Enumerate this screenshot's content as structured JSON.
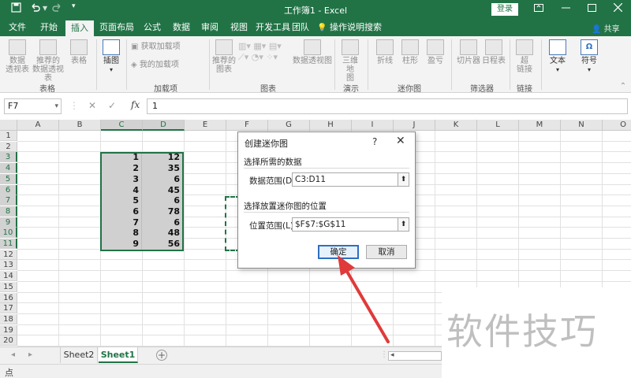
{
  "colors": {
    "excel_green": "#217346",
    "arrow_red": "#e03a3a"
  },
  "window": {
    "title": "工作簿1 - Excel",
    "login_label": "登录",
    "share_label": "共享",
    "qat": {
      "save_icon": "save-icon",
      "undo_icon": "undo-icon",
      "redo_icon": "redo-icon",
      "customize_icon": "chevron-down-icon"
    },
    "controls": {
      "restore": "restore-icon",
      "minimize": "minimize-icon",
      "maximize": "maximize-icon",
      "close": "close-icon"
    }
  },
  "ribbon": {
    "tabs": [
      "文件",
      "开始",
      "插入",
      "页面布局",
      "公式",
      "数据",
      "审阅",
      "视图",
      "开发工具",
      "团队",
      "操作说明搜索"
    ],
    "active_tab": "插入",
    "items": {
      "pivot_table": "数据\n透视表",
      "recommended_pivot": "推荐的\n数据透视表",
      "table": "表格",
      "illustrations": "插图",
      "get_addins": "获取加载项",
      "my_addins": "我的加载项",
      "recommended_charts": "推荐的\n图表",
      "pivot_chart": "数据透视图",
      "map3d": "三维地\n图",
      "line": "折线",
      "column": "柱形",
      "win_loss": "盈亏",
      "slicer": "切片器",
      "timeline": "日程表",
      "link": "超\n链接",
      "text": "文本",
      "symbols": "符号"
    },
    "groups": [
      "表格",
      "加载项",
      "图表",
      "演示",
      "迷你图",
      "筛选器",
      "链接"
    ]
  },
  "formula_bar": {
    "name_box": "F7",
    "fx_label": "fx",
    "value": "1"
  },
  "grid": {
    "columns": [
      "A",
      "B",
      "C",
      "D",
      "E",
      "F",
      "G",
      "H",
      "I",
      "J",
      "K",
      "L",
      "M",
      "N",
      "O"
    ],
    "rows": [
      "1",
      "2",
      "3",
      "4",
      "5",
      "6",
      "7",
      "8",
      "9",
      "10",
      "11",
      "12",
      "13",
      "14",
      "15",
      "16",
      "17",
      "18",
      "19",
      "20"
    ],
    "col_c_values": [
      "1",
      "2",
      "3",
      "4",
      "5",
      "6",
      "7",
      "8",
      "9"
    ],
    "col_d_values": [
      "12",
      "35",
      "6",
      "45",
      "6",
      "78",
      "6",
      "48",
      "56"
    ]
  },
  "dialog": {
    "title": "创建迷你图",
    "help": "?",
    "close": "✕",
    "section_data": "选择所需的数据",
    "data_range_label": "数据范围(D):",
    "data_range_value": "C3:D11",
    "section_location": "选择放置迷你图的位置",
    "location_label": "位置范围(L):",
    "location_value": "$F$7:$G$11",
    "ok": "确定",
    "cancel": "取消"
  },
  "sheets": {
    "tabs": [
      "Sheet2",
      "Sheet1"
    ],
    "active": "Sheet1"
  },
  "status": {
    "mode": "点"
  },
  "watermark": "软件技巧"
}
